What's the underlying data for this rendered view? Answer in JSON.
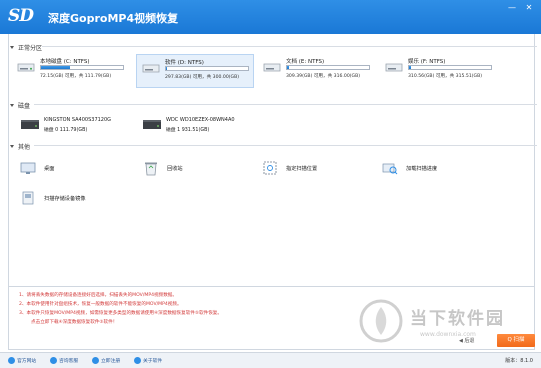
{
  "window": {
    "title": "深度GoproMP4视频恢复",
    "logo_text": "SD",
    "minimize": "—",
    "close": "✕"
  },
  "sections": {
    "partitions": "正常分区",
    "disks": "磁盘",
    "others": "其他"
  },
  "drives": [
    {
      "name": "本地磁盘 (C: NTFS)",
      "info": "72.15(GB) 可用，共 111.79(GB)",
      "used_fraction": 0.35,
      "selected": false
    },
    {
      "name": "软件 (D: NTFS)",
      "info": "297.83(GB) 可用，共 300.00(GB)",
      "used_fraction": 0.01,
      "selected": true
    },
    {
      "name": "文档 (E: NTFS)",
      "info": "309.39(GB) 可用，共 316.00(GB)",
      "used_fraction": 0.02,
      "selected": false
    },
    {
      "name": "娱乐 (F: NTFS)",
      "info": "310.56(GB) 可用，共 315.51(GB)",
      "used_fraction": 0.02,
      "selected": false
    }
  ],
  "disks": [
    {
      "name": "KINGSTON SA400S37120G",
      "info": "磁盘 0   111.79(GB)"
    },
    {
      "name": "WDC WD10EZEX-08WN4A0",
      "info": "磁盘 1   931.51(GB)"
    }
  ],
  "others": [
    {
      "label": "桌面",
      "icon": "desktop-icon"
    },
    {
      "label": "回收站",
      "icon": "recycle-bin-icon"
    },
    {
      "label": "指定扫描位置",
      "icon": "scan-location-icon"
    },
    {
      "label": "加载扫描进度",
      "icon": "load-progress-icon"
    },
    {
      "label": "扫描存储设备镜像",
      "icon": "device-image-icon"
    }
  ],
  "notes": [
    "1、请将丢失数据的存储设备连接好后选择，扫描丢失的MOV/MP4视频数据。",
    "2、本软件使用针对盘组技术，恢复一般数据的软件不能恢复的MOV/MP4视频。",
    "3、本软件只恢复MOV/MP4视频，如需恢复更多类型的数据请使用④深度数据恢复软件⑤软件恢复。",
    "点击立即下载④深度数据恢复软件⑤软件！"
  ],
  "buttons": {
    "prev": "◀ 后退",
    "next": "Q 扫描"
  },
  "watermark": {
    "text": "当下软件园",
    "url": "www.downxia.com"
  },
  "status": {
    "items": [
      "官方网站",
      "咨询客服",
      "立即注册",
      "关于软件"
    ],
    "version": "版本：8.1.0"
  },
  "colors": {
    "title_bar": "#1a78d6",
    "accent": "#2f8fe6",
    "next_button": "#f26a1b",
    "note_text": "#d23a3a"
  }
}
